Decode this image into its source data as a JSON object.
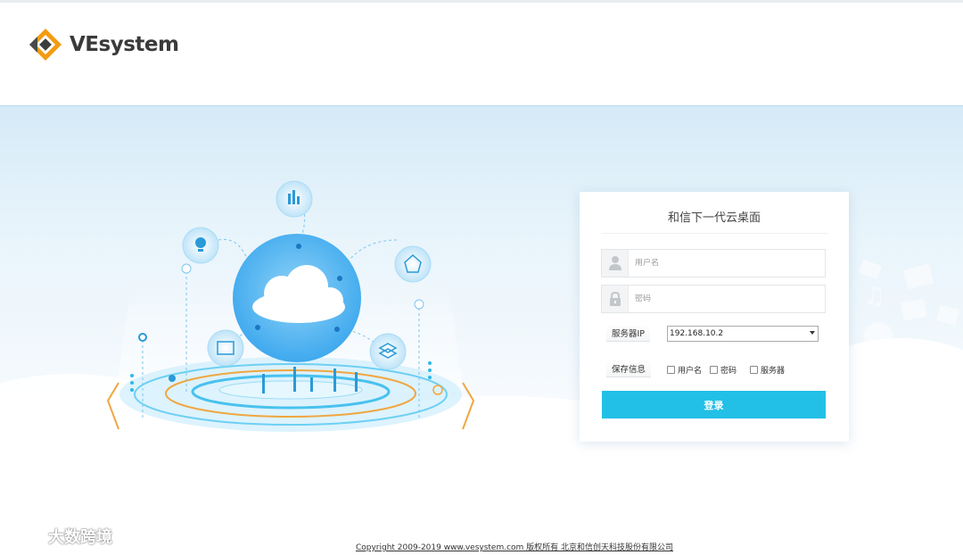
{
  "brand": {
    "name": "VEsystem"
  },
  "login": {
    "title": "和信下一代云桌面",
    "username_placeholder": "用户名",
    "password_placeholder": "密码",
    "server_label": "服务器IP",
    "server_value": "192.168.10.2",
    "save_label": "保存信息",
    "save_options": [
      "用户名",
      "密码",
      "服务器"
    ],
    "submit_label": "登录"
  },
  "footer": {
    "copyright": "Copyright 2009-2019 www.vesystem.com 版权所有 北京和信创天科技股份有限公司"
  },
  "watermark": {
    "text": "大数跨境"
  },
  "colors": {
    "accent": "#22c0e6",
    "logo_orange": "#f39c12",
    "logo_dark": "#3a3a3a",
    "banner_blue": "#d5eaf7"
  }
}
